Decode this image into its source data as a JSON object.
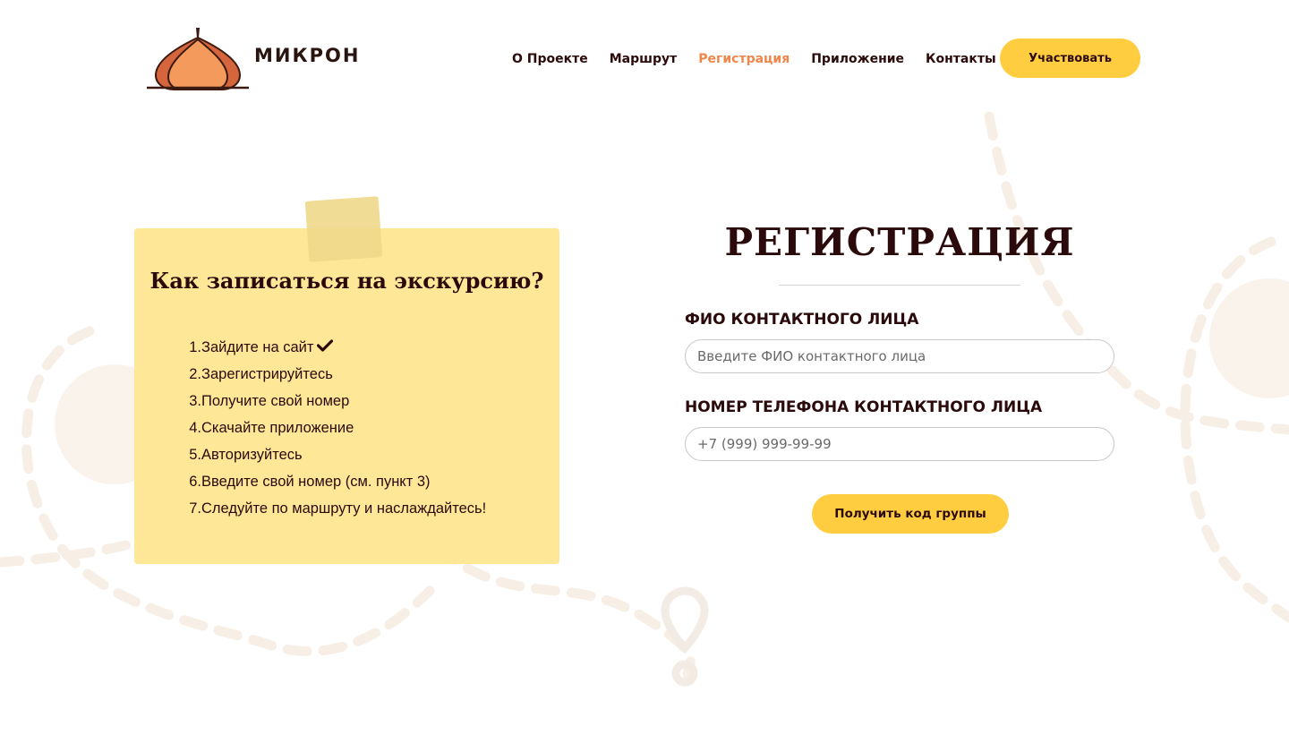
{
  "brand": {
    "name": "МИКРОН",
    "icon": "onion-dome-logo-icon"
  },
  "nav": {
    "items": [
      {
        "label": "О Проекте",
        "active": false
      },
      {
        "label": "Маршрут",
        "active": false
      },
      {
        "label": "Регистрация",
        "active": true
      },
      {
        "label": "Приложение",
        "active": false
      },
      {
        "label": "Контакты",
        "active": false
      }
    ],
    "cta_label": "Участвовать"
  },
  "instructions": {
    "title": "Как записаться на экскурсию?",
    "steps": [
      {
        "num": "1.",
        "text": "Зайдите на сайт",
        "done": true
      },
      {
        "num": "2.",
        "text": "Зарегистрируйтесь",
        "done": false
      },
      {
        "num": "3.",
        "text": "Получите свой номер",
        "done": false
      },
      {
        "num": "4.",
        "text": "Скачайте приложение",
        "done": false
      },
      {
        "num": "5.",
        "text": "Авторизуйтесь",
        "done": false
      },
      {
        "num": "6.",
        "text": "Введите свой номер (см. пункт 3)",
        "done": false
      },
      {
        "num": "7.",
        "text": "Следуйте по маршруту и наслаждайтесь!",
        "done": false
      }
    ],
    "check_icon": "checkmark-icon"
  },
  "registration": {
    "title": "РЕГИСТРАЦИЯ",
    "fields": [
      {
        "label": "ФИО КОНТАКТНОГО ЛИЦА",
        "placeholder": "Введите ФИО контактного лица",
        "value": ""
      },
      {
        "label": "НОМЕР ТЕЛЕФОНА КОНТАКТНОГО ЛИЦА",
        "placeholder": "+7 (999) 999-99-99",
        "value": ""
      }
    ],
    "submit_label": "Получить код группы"
  },
  "colors": {
    "accent": "#ffcd3f",
    "active_nav": "#f0874a",
    "card": "#fee796",
    "text": "#2a0a0a"
  }
}
